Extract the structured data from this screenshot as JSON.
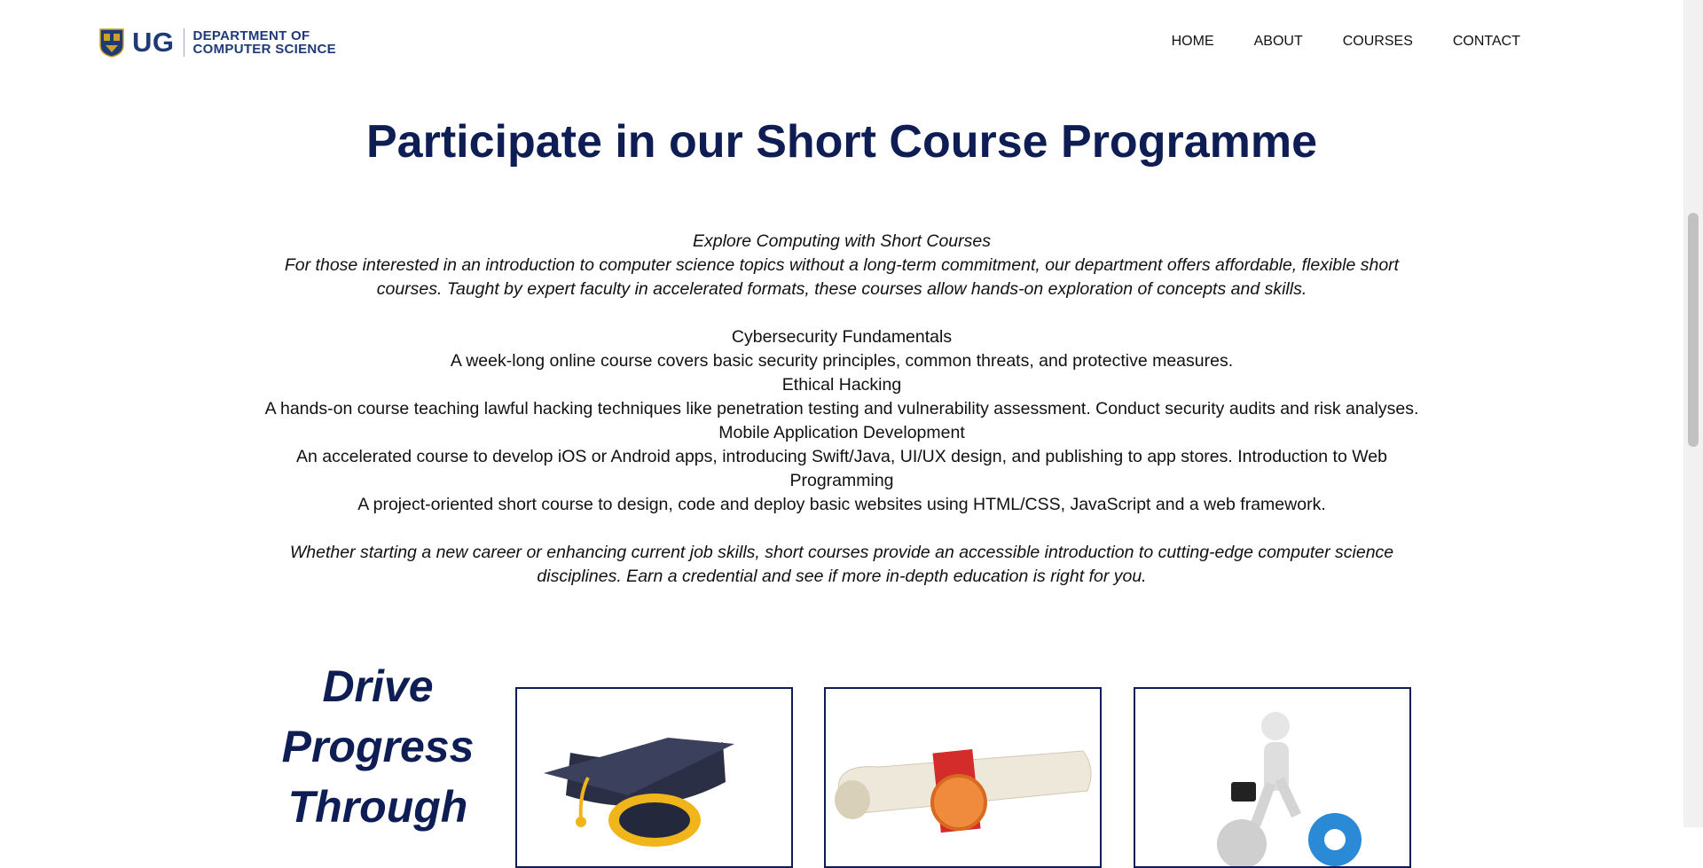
{
  "header": {
    "logo_ug": "UG",
    "logo_line1": "DEPARTMENT OF",
    "logo_line2": "COMPUTER SCIENCE",
    "nav": [
      "HOME",
      "ABOUT",
      "COURSES",
      "CONTACT"
    ]
  },
  "main": {
    "title": "Participate in our Short Course Programme",
    "intro_heading": "Explore Computing with Short Courses",
    "intro_text": "For those interested in an introduction to computer science topics without a long-term commitment, our department offers affordable, flexible short courses. Taught by expert faculty in accelerated formats, these courses allow hands-on exploration of concepts and skills.",
    "courses": [
      {
        "name": "Cybersecurity Fundamentals",
        "desc": "A week-long online course covers basic security principles, common threats, and protective measures."
      },
      {
        "name": "Ethical Hacking",
        "desc": "A hands-on course teaching lawful hacking techniques like penetration testing and vulnerability assessment. Conduct security audits and risk analyses."
      },
      {
        "name": "Mobile Application Development",
        "desc": "An accelerated course to develop iOS or Android apps, introducing Swift/Java, UI/UX design, and publishing to app stores. Introduction to Web Programming"
      },
      {
        "name": "",
        "desc": "A project-oriented short course to design, code and deploy basic websites using HTML/CSS, JavaScript and a web framework."
      }
    ],
    "closing": "Whether starting a new career or enhancing current job skills, short courses provide an accessible introduction to cutting-edge computer science disciplines. Earn a credential and see if more in-depth education is right for you."
  },
  "promo": {
    "heading_lines": [
      "Drive",
      "Progress",
      "Through"
    ],
    "cards": [
      "graduation-cap-image",
      "diploma-scroll-image",
      "businessman-gears-image"
    ]
  },
  "colors": {
    "navy": "#0e1e55",
    "logo_blue": "#1f3b77"
  }
}
